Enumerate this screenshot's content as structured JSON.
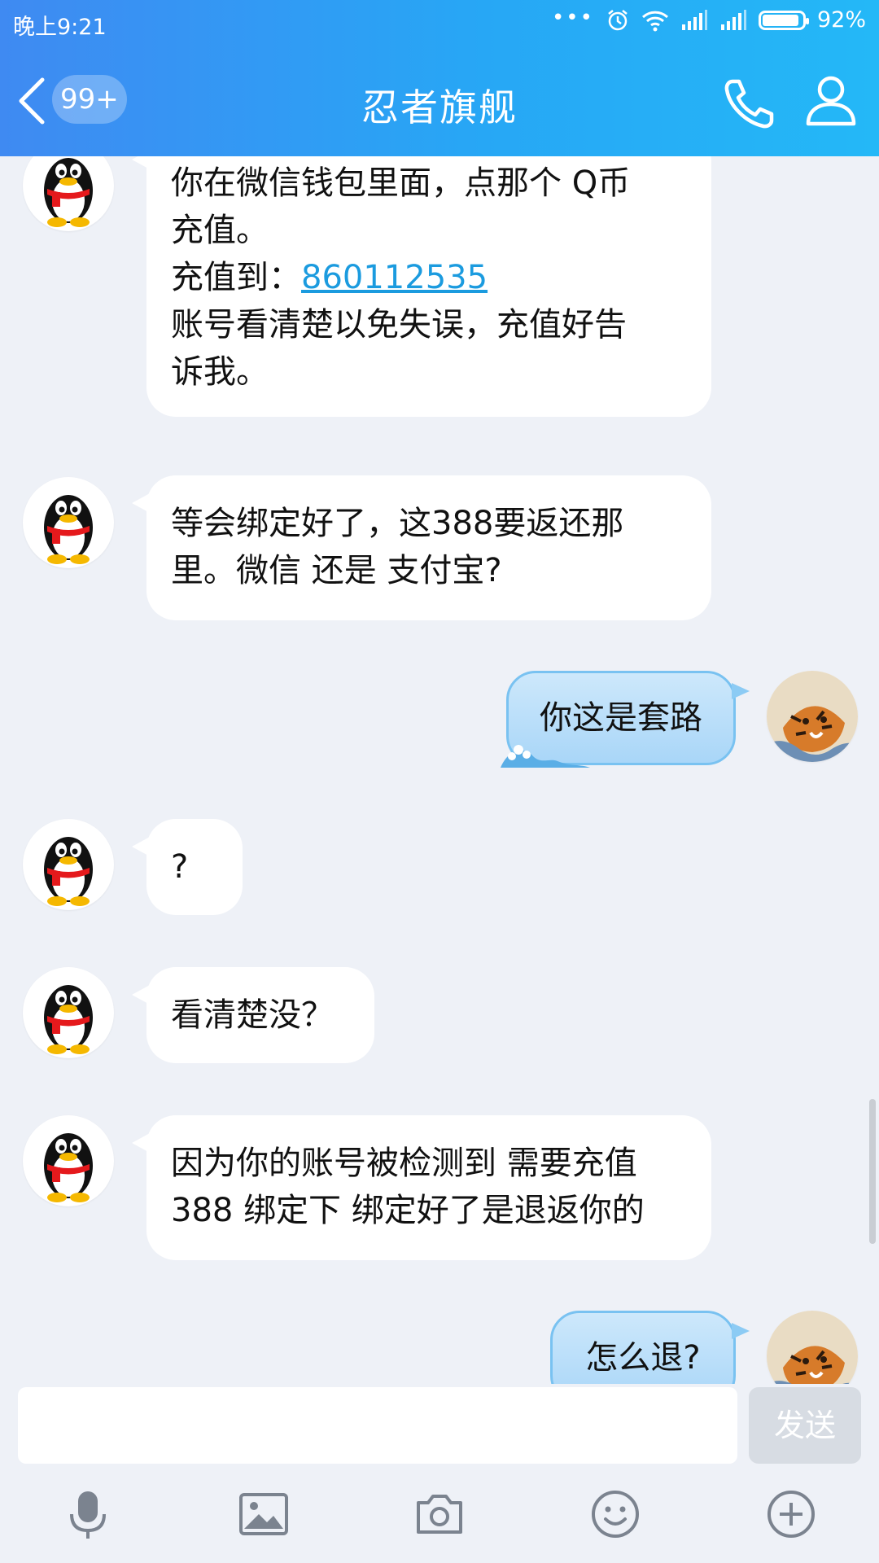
{
  "status_bar": {
    "time": "晚上9:21",
    "dots": "•••",
    "battery_percent": "92%",
    "battery_level": 0.92
  },
  "header": {
    "title": "忍者旗舰",
    "unread_badge": "99+"
  },
  "messages": [
    {
      "side": "in",
      "lines": [
        "你在微信钱包里面，点那个 Q币",
        "充值。"
      ],
      "line2_prefix": "充值到：",
      "link": "860112535",
      "lines_after": [
        "账号看清楚以免失误，充值好告",
        "诉我。"
      ]
    },
    {
      "side": "in",
      "lines": [
        "等会绑定好了，这388要返还那",
        "里。微信 还是 支付宝?"
      ]
    },
    {
      "side": "out",
      "text": "你这是套路"
    },
    {
      "side": "in",
      "text": "?"
    },
    {
      "side": "in",
      "text": "看清楚没？"
    },
    {
      "side": "in",
      "lines": [
        "因为你的账号被检测到 需要充值",
        "388 绑定下 绑定好了是退返你的"
      ]
    },
    {
      "side": "out",
      "text": "怎么退?"
    }
  ],
  "input": {
    "placeholder": "",
    "send_label": "发送"
  },
  "toolbar": {
    "items": [
      "mic-icon",
      "image-icon",
      "camera-icon",
      "emoji-icon",
      "plus-icon"
    ]
  },
  "colors": {
    "header_start": "#3f8af2",
    "header_end": "#24b8f7",
    "link": "#1b9bdf",
    "chat_bg": "#eef1f7"
  }
}
